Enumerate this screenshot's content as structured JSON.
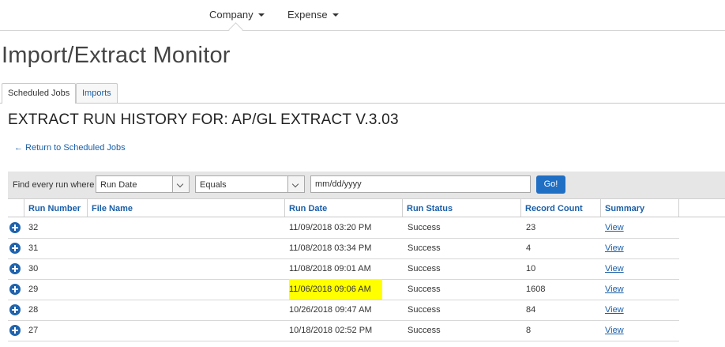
{
  "nav": {
    "items": [
      {
        "label": "Company"
      },
      {
        "label": "Expense"
      }
    ]
  },
  "page_title": "Import/Extract Monitor",
  "tabs": [
    {
      "label": "Scheduled Jobs",
      "active": true
    },
    {
      "label": "Imports",
      "active": false
    }
  ],
  "subtitle": "EXTRACT RUN HISTORY FOR: AP/GL EXTRACT V.3.03",
  "back_link": "← Return to Scheduled Jobs",
  "filter": {
    "label": "Find every run where",
    "field": "Run Date",
    "operator": "Equals",
    "value_placeholder": "mm/dd/yyyy",
    "go_label": "Go!"
  },
  "table": {
    "columns": [
      "Run Number",
      "File Name",
      "Run Date",
      "Run Status",
      "Record Count",
      "Summary"
    ],
    "rows": [
      {
        "run_number": "32",
        "file_name": "",
        "run_date": "11/09/2018 03:20 PM",
        "run_status": "Success",
        "record_count": "23",
        "summary": "View",
        "highlight": false
      },
      {
        "run_number": "31",
        "file_name": "",
        "run_date": "11/08/2018 03:34 PM",
        "run_status": "Success",
        "record_count": "4",
        "summary": "View",
        "highlight": false
      },
      {
        "run_number": "30",
        "file_name": "",
        "run_date": "11/08/2018 09:01 AM",
        "run_status": "Success",
        "record_count": "10",
        "summary": "View",
        "highlight": false
      },
      {
        "run_number": "29",
        "file_name": "",
        "run_date": "11/06/2018 09:06 AM",
        "run_status": "Success",
        "record_count": "1608",
        "summary": "View",
        "highlight": true
      },
      {
        "run_number": "28",
        "file_name": "",
        "run_date": "10/26/2018 09:47 AM",
        "run_status": "Success",
        "record_count": "84",
        "summary": "View",
        "highlight": false
      },
      {
        "run_number": "27",
        "file_name": "",
        "run_date": "10/18/2018 02:52 PM",
        "run_status": "Success",
        "record_count": "8",
        "summary": "View",
        "highlight": false
      }
    ]
  },
  "colors": {
    "accent": "#1f6fc4",
    "link": "#1a5fa8",
    "highlight": "#ffff00"
  }
}
